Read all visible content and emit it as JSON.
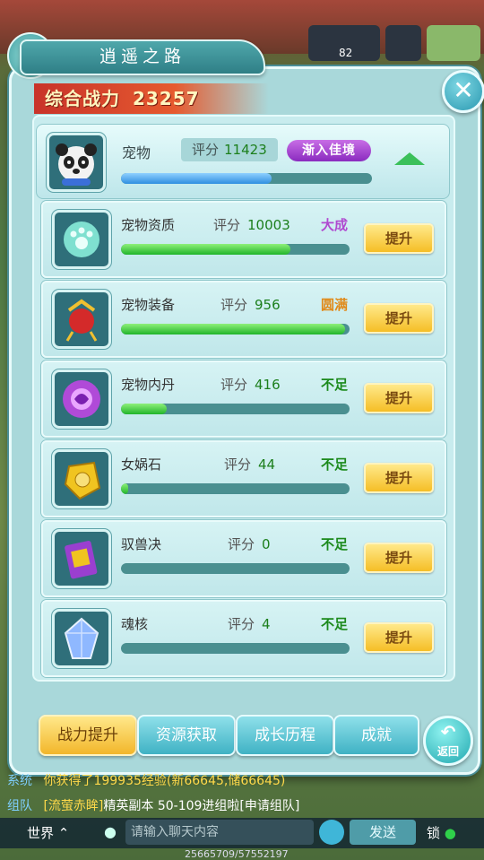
{
  "header": {
    "title": "逍遥之路",
    "power_label": "综合战力",
    "power_value": "23257",
    "top_level": "82"
  },
  "pet": {
    "name": "宠物",
    "score_label": "评分",
    "score": "11423",
    "tag": "渐入佳境",
    "progress": 0.6
  },
  "rows": [
    {
      "name": "宠物资质",
      "score_label": "评分",
      "score": "10003",
      "status": "大成",
      "status_color": "#b04ad0",
      "progress": 0.74,
      "button": "提升",
      "icon": "paw-orb-icon"
    },
    {
      "name": "宠物装备",
      "score_label": "评分",
      "score": "956",
      "status": "圆满",
      "status_color": "#e08a1a",
      "progress": 0.98,
      "button": "提升",
      "icon": "bell-equipment-icon"
    },
    {
      "name": "宠物内丹",
      "score_label": "评分",
      "score": "416",
      "status": "不足",
      "status_color": "#1c8a1c",
      "progress": 0.2,
      "button": "提升",
      "icon": "purple-orb-icon"
    },
    {
      "name": "女娲石",
      "score_label": "评分",
      "score": "44",
      "status": "不足",
      "status_color": "#1c8a1c",
      "progress": 0.03,
      "button": "提升",
      "icon": "gold-stone-icon"
    },
    {
      "name": "驭兽决",
      "score_label": "评分",
      "score": "0",
      "status": "不足",
      "status_color": "#1c8a1c",
      "progress": 0.0,
      "button": "提升",
      "icon": "book-icon"
    },
    {
      "name": "魂核",
      "score_label": "评分",
      "score": "4",
      "status": "不足",
      "status_color": "#1c8a1c",
      "progress": 0.0,
      "button": "提升",
      "icon": "crystal-icon"
    }
  ],
  "tabs": [
    {
      "label": "战力提升",
      "active": true
    },
    {
      "label": "资源获取",
      "active": false
    },
    {
      "label": "成长历程",
      "active": false
    },
    {
      "label": "成就",
      "active": false
    }
  ],
  "back_label": "返回",
  "chat": {
    "line1_channel": "系统",
    "line1_text": "你获得了199935经验(新66645,储66645)",
    "line2_channel": "组队",
    "line2_name": "[流萤赤眸]",
    "line2_text": "精英副本 50-109进组啦[申请组队]"
  },
  "bottom_bar": {
    "world": "世界",
    "input_placeholder": "请输入聊天内容",
    "send": "发送",
    "lock": "锁",
    "coords": "25665709/57552197"
  }
}
